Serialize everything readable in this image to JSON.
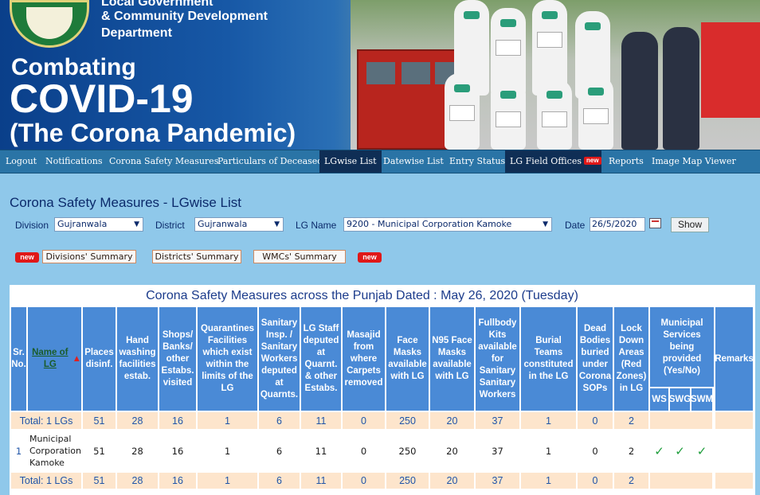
{
  "banner": {
    "dept_line1": "Local Government",
    "dept_line2": "& Community Development",
    "dept_line3": "Department",
    "combating": "Combating",
    "covid": "COVID-19",
    "pandemic": "(The Corona Pandemic)"
  },
  "nav": {
    "items": [
      "Logout",
      "Notifications",
      "Corona Safety Measures",
      "Particulars of Deceased",
      "LGwise List",
      "Datewise List",
      "Entry Status",
      "LG Field Offices",
      "Reports",
      "Image Map Viewer"
    ],
    "active_index": 4,
    "new_badge": "new"
  },
  "page": {
    "title": "Corona Safety Measures - LGwise List"
  },
  "filters": {
    "division_label": "Division",
    "division_value": "Gujranwala",
    "district_label": "District",
    "district_value": "Gujranwala",
    "lg_label": "LG Name",
    "lg_value": "9200 - Municipal Corporation Kamoke",
    "date_label": "Date",
    "date_value": "26/5/2020",
    "show_label": "Show"
  },
  "summaries": {
    "new_label": "new",
    "divisions": "Divisions' Summary",
    "districts": "Districts' Summary",
    "wmcs": "WMCs' Summary"
  },
  "table": {
    "caption": "Corona Safety Measures across the Punjab Dated : May 26, 2020 (Tuesday)",
    "headers": [
      "Sr. No.",
      "Name of LG",
      "Places disinf.",
      "Hand washing facilities estab.",
      "Shops/ Banks/ other Estabs. visited",
      "Quarantines Facilities which exist within the limits of the LG",
      "Sanitary Insp. / Sanitary Workers deputed at Quarnts.",
      "LG Staff deputed at Quarnt. & other Estabs.",
      "Masajid from where Carpets removed",
      "Face Masks available with LG",
      "N95 Face Masks available with LG",
      "Fullbody Kits available for Sanitary Sanitary Workers",
      "Burial Teams constituted in the LG",
      "Dead Bodies buried under Corona SOPs",
      "Lock Down Areas (Red Zones) in LG",
      "Municipal Services being provided (Yes/No)",
      "Remarks"
    ],
    "sub_headers": [
      "WS",
      "SWG",
      "SWM"
    ],
    "total_label": "Total: 1 LGs",
    "totals": [
      "51",
      "28",
      "16",
      "1",
      "6",
      "11",
      "0",
      "250",
      "20",
      "37",
      "1",
      "0",
      "2"
    ],
    "rows": [
      {
        "sr": "1",
        "name": "Municipal Corporation Kamoke",
        "values": [
          "51",
          "28",
          "16",
          "1",
          "6",
          "11",
          "0",
          "250",
          "20",
          "37",
          "1",
          "0",
          "2"
        ],
        "services": [
          "✓",
          "✓",
          "✓"
        ]
      }
    ]
  }
}
